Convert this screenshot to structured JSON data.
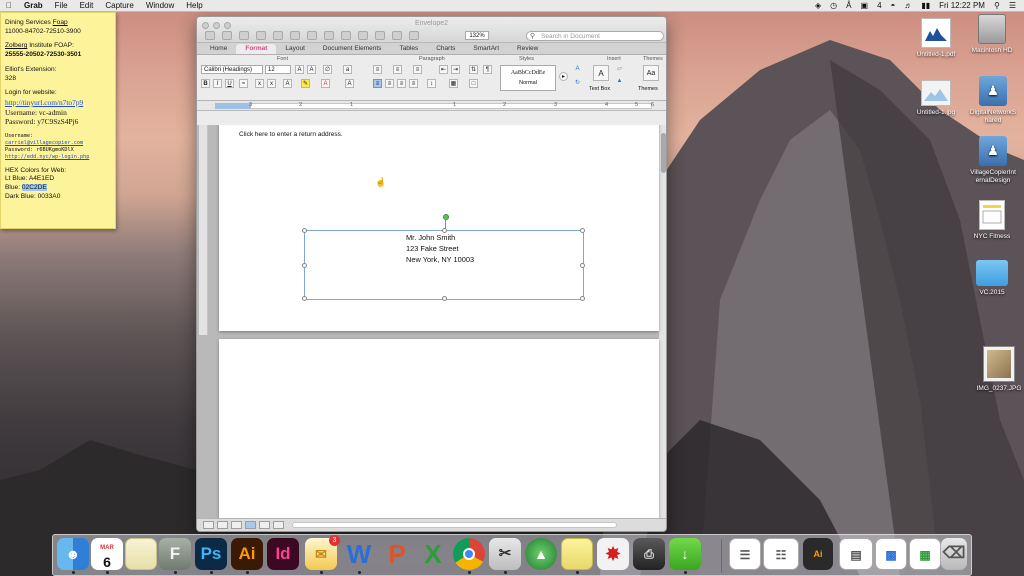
{
  "menubar": {
    "apple": "",
    "items": [
      "Grab",
      "File",
      "Edit",
      "Capture",
      "Window",
      "Help"
    ],
    "status_four": "4",
    "clock": "Fri 12:22 PM"
  },
  "sticky": {
    "line1": "Dining Services ",
    "line1u": "Foap",
    "line2": "11000-84702-72510-3900",
    "line3a": "Zolberg",
    "line3b": " Institute FOAP:",
    "line4": "25555-20502-72530-3501",
    "line5": "Elliot's Extension:",
    "line6": "328",
    "line7": "Login for website:",
    "link1": "http://tinyurl.com/n7to7p9",
    "user1": "Username: vc-admin",
    "pass1": "Password: y7C9SzS4Pj6",
    "label_username": "Username:",
    "email": "carriel@villagecopier.com",
    "pass2": "Password: r6BUKgmoKDlX",
    "link2": "http://edd.nyc/wp-login.php",
    "hex_title": "HEX Colors for Web:",
    "ltblue_label": "Lt Blue: ",
    "ltblue": "A4E1ED",
    "blue_label": "Blue: ",
    "blue": "02C2DE",
    "darkblue_label": "Dark Blue: ",
    "darkblue": "0033A0"
  },
  "word": {
    "title": "Envelope2",
    "zoom": "132%",
    "search_placeholder": "Search in Document",
    "tabs": [
      "Home",
      "Format",
      "Layout",
      "Document Elements",
      "Tables",
      "Charts",
      "SmartArt",
      "Review"
    ],
    "active_tab": "Format",
    "groups": {
      "font": "Font",
      "paragraph": "Paragraph",
      "styles": "Styles",
      "insert": "Insert",
      "themes": "Themes"
    },
    "font_name": "Calibri (Headings)",
    "font_size": "12",
    "style_sample": "AaBbCcDdEe",
    "style_name": "Normal",
    "text_box_label": "Text Box",
    "themes_label": "Themes",
    "ruler_numbers": [
      "3",
      "2",
      "1",
      "1",
      "2",
      "3",
      "4",
      "5",
      "6"
    ],
    "return_address_placeholder": "Click here to enter a return address.",
    "address_lines": [
      "Mr. John Smith",
      "123 Fake Street",
      "New York, NY 10003"
    ]
  },
  "desktop_icons": [
    {
      "label": "Untitled-1.pdf"
    },
    {
      "label": "Macintosh HD"
    },
    {
      "label": "Untitled-1.jpg"
    },
    {
      "label": "DigitalNetworkS hared"
    },
    {
      "label": "VillageCopierInt ernalDesign"
    },
    {
      "label": "NYC Fitness"
    },
    {
      "label": "VC.2015"
    },
    {
      "label": "IMG_0237.JPG"
    }
  ],
  "dock": {
    "calendar_month": "MAR",
    "calendar_day": "6",
    "mail_badge": "3",
    "apps": [
      "Finder",
      "Calendar",
      "Notes",
      "Font Book",
      "Photoshop",
      "Illustrator",
      "InDesign",
      "Mail",
      "Word",
      "PowerPoint",
      "Excel",
      "Chrome",
      "Grab",
      "Stickies",
      "Acrobat",
      "Bridge",
      "Printer",
      "Downloads",
      "Trash"
    ],
    "photoshop": "Ps",
    "illustrator": "Ai",
    "indesign": "Id",
    "fontbook": "F",
    "word": "W",
    "powerpoint": "P",
    "excel": "X"
  },
  "colors": {
    "accent_tab": "#d9458a",
    "selection": "#7ea6d8",
    "sticky": "#fdf39a"
  }
}
